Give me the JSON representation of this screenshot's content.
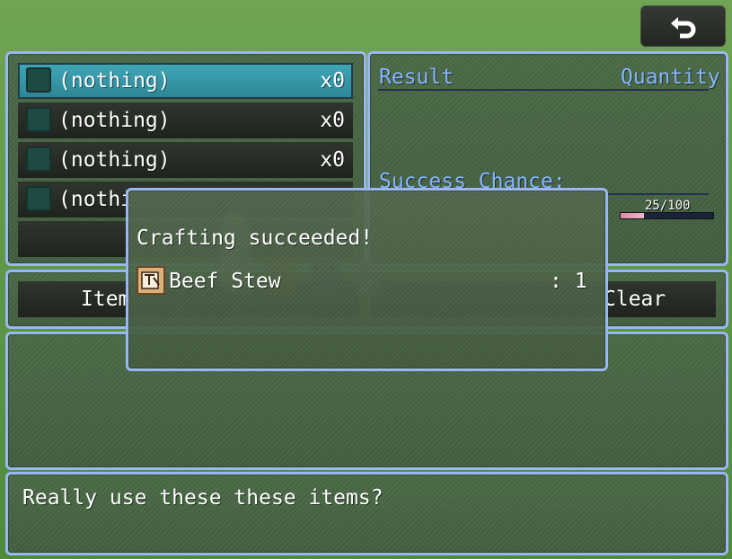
{
  "back_button": {
    "icon": "return-arrow-icon"
  },
  "ingredient_list": {
    "items": [
      {
        "label": "(nothing)",
        "qty": "x0"
      },
      {
        "label": "(nothing)",
        "qty": "x0"
      },
      {
        "label": "(nothing)",
        "qty": "x0"
      },
      {
        "label": "(nothi",
        "qty": ""
      }
    ]
  },
  "result_panel": {
    "result_label": "Result",
    "quantity_label": "Quantity",
    "success_label": "Success Chance:",
    "gauge_text": "25/100",
    "gauge_value": 0.25,
    "gauge_color": "#e08aa0"
  },
  "command_row": {
    "items_label": "Item",
    "clear_label": "Clear"
  },
  "help_text": "Really use these these items?",
  "popup": {
    "title": "Crafting succeeded!",
    "item_name": "Beef Stew",
    "item_count": ": 1",
    "item_icon": "food-icon"
  },
  "colors": {
    "window_border": "#9ab8ef",
    "system_text": "#84b6ff",
    "selected_slot": "#3fa6b5"
  }
}
